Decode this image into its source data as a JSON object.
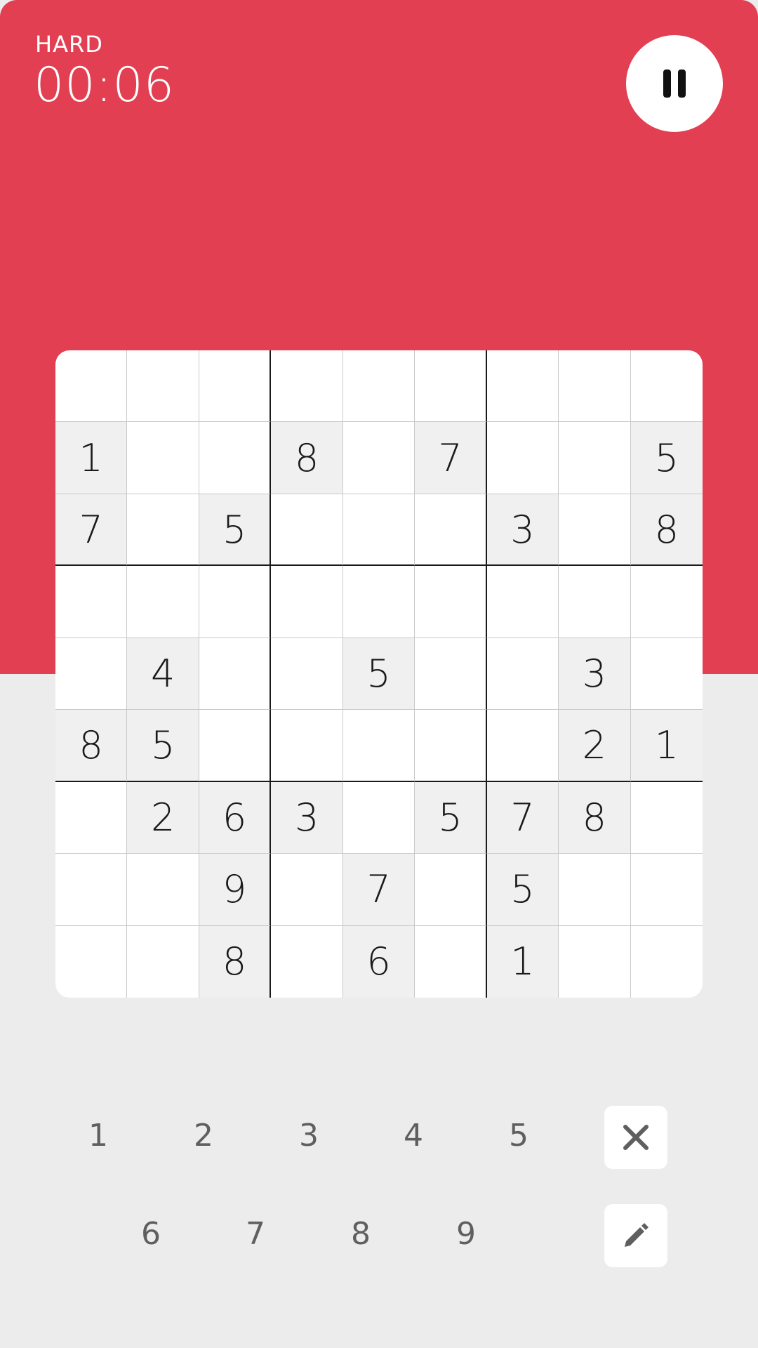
{
  "header": {
    "difficulty": "HARD",
    "timer": "00:06",
    "pause_icon": "pause-icon"
  },
  "board": {
    "rows": [
      [
        "",
        "",
        "",
        "",
        "",
        "",
        "",
        "",
        ""
      ],
      [
        "1",
        "",
        "",
        "8",
        "",
        "7",
        "",
        "",
        "5"
      ],
      [
        "7",
        "",
        "5",
        "",
        "",
        "",
        "3",
        "",
        "8"
      ],
      [
        "",
        "",
        "",
        "",
        "",
        "",
        "",
        "",
        ""
      ],
      [
        "",
        "4",
        "",
        "",
        "5",
        "",
        "",
        "3",
        ""
      ],
      [
        "8",
        "5",
        "",
        "",
        "",
        "",
        "",
        "2",
        "1"
      ],
      [
        "",
        "2",
        "6",
        "3",
        "",
        "5",
        "7",
        "8",
        ""
      ],
      [
        "",
        "",
        "9",
        "",
        "7",
        "",
        "5",
        "",
        ""
      ],
      [
        "",
        "",
        "8",
        "",
        "6",
        "",
        "1",
        "",
        ""
      ]
    ]
  },
  "numpad": {
    "row1": [
      "1",
      "2",
      "3",
      "4",
      "5"
    ],
    "row2": [
      "6",
      "7",
      "8",
      "9"
    ]
  },
  "tools": {
    "erase_icon": "close-icon",
    "notes_icon": "pencil-icon"
  },
  "colors": {
    "accent": "#e23f52",
    "background": "#ececec",
    "given_cell": "#f0f0f0"
  }
}
